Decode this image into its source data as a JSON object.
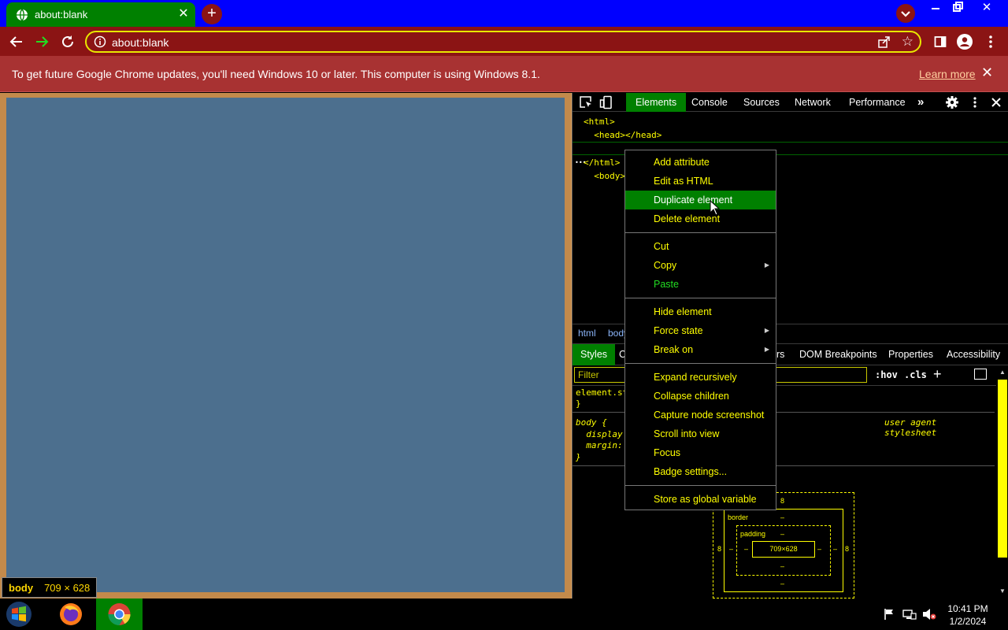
{
  "browser": {
    "tab": {
      "title": "about:blank"
    },
    "new_tab_symbol": "+",
    "window": {
      "minimize": "—",
      "close": "✕"
    },
    "toolbar": {
      "url": "about:blank"
    },
    "infobar": {
      "message": "To get future Google Chrome updates, you'll need Windows 10 or later. This computer is using Windows 8.1.",
      "link": "Learn more",
      "close": "✕"
    }
  },
  "page_tooltip": {
    "tag": "body",
    "size": "709 × 628"
  },
  "devtools": {
    "tabs": [
      "Elements",
      "Console",
      "Sources",
      "Network",
      "Performance"
    ],
    "more_tabs": "»",
    "dom": [
      "<html>",
      "  <head></head>",
      "  <body></body> == $0",
      "</html>"
    ],
    "dom_ellipsis": "•••",
    "breadcrumbs": [
      "html",
      "body"
    ],
    "subtabs": [
      "Styles",
      "C",
      "rs",
      "DOM Breakpoints",
      "Properties",
      "Accessibility"
    ],
    "filter_placeholder": "Filter",
    "hov": ":hov",
    "cls": ".cls",
    "styles": {
      "element_style_open": "element.st",
      "element_style_close": "}",
      "body_rule_open": "body {",
      "prop1": "  display",
      "prop2": "  margin:",
      "body_rule_close": "}",
      "source": "user agent stylesheet"
    },
    "box_model": {
      "margin_top": "8",
      "border_label": "border",
      "border_top": "–",
      "padding_label": "padding",
      "padding_top": "–",
      "content": "709×628",
      "margin_left": "8",
      "margin_right": "8",
      "border_left": "–",
      "border_right": "–",
      "padding_left": "–",
      "padding_right": "–",
      "padding_bottom": "–",
      "border_bottom": "–"
    }
  },
  "context_menu": {
    "groups": [
      [
        "Add attribute",
        "Edit as HTML",
        "Duplicate element",
        "Delete element"
      ],
      [
        "Cut",
        "Copy",
        "Paste"
      ],
      [
        "Hide element",
        "Force state",
        "Break on"
      ],
      [
        "Expand recursively",
        "Collapse children",
        "Capture node screenshot",
        "Scroll into view",
        "Focus",
        "Badge settings..."
      ],
      [
        "Store as global variable"
      ]
    ],
    "highlighted": "Duplicate element",
    "submenu_arrow": "▶"
  },
  "taskbar": {
    "clock_time": "10:41 PM",
    "clock_date": "1/2/2024"
  },
  "colors": {
    "tab_strip": "#0000ff",
    "active_tab": "#008000",
    "toolbar": "#8b1414",
    "infobar": "#a83232",
    "page_content": "#4c6f8e",
    "devtools_text": "#ffff00",
    "highlight": "#008000"
  },
  "icons": [
    "globe-icon",
    "back-icon",
    "forward-icon",
    "reload-icon",
    "info-icon",
    "share-icon",
    "star-icon",
    "sidepanel-icon",
    "profile-icon",
    "menu-icon",
    "inspect-icon",
    "device-icon",
    "gear-icon",
    "kebab-icon",
    "close-icon",
    "windows-start-icon",
    "firefox-icon",
    "chrome-icon",
    "flag-icon",
    "network-icon",
    "volume-muted-icon",
    "cursor-icon"
  ]
}
